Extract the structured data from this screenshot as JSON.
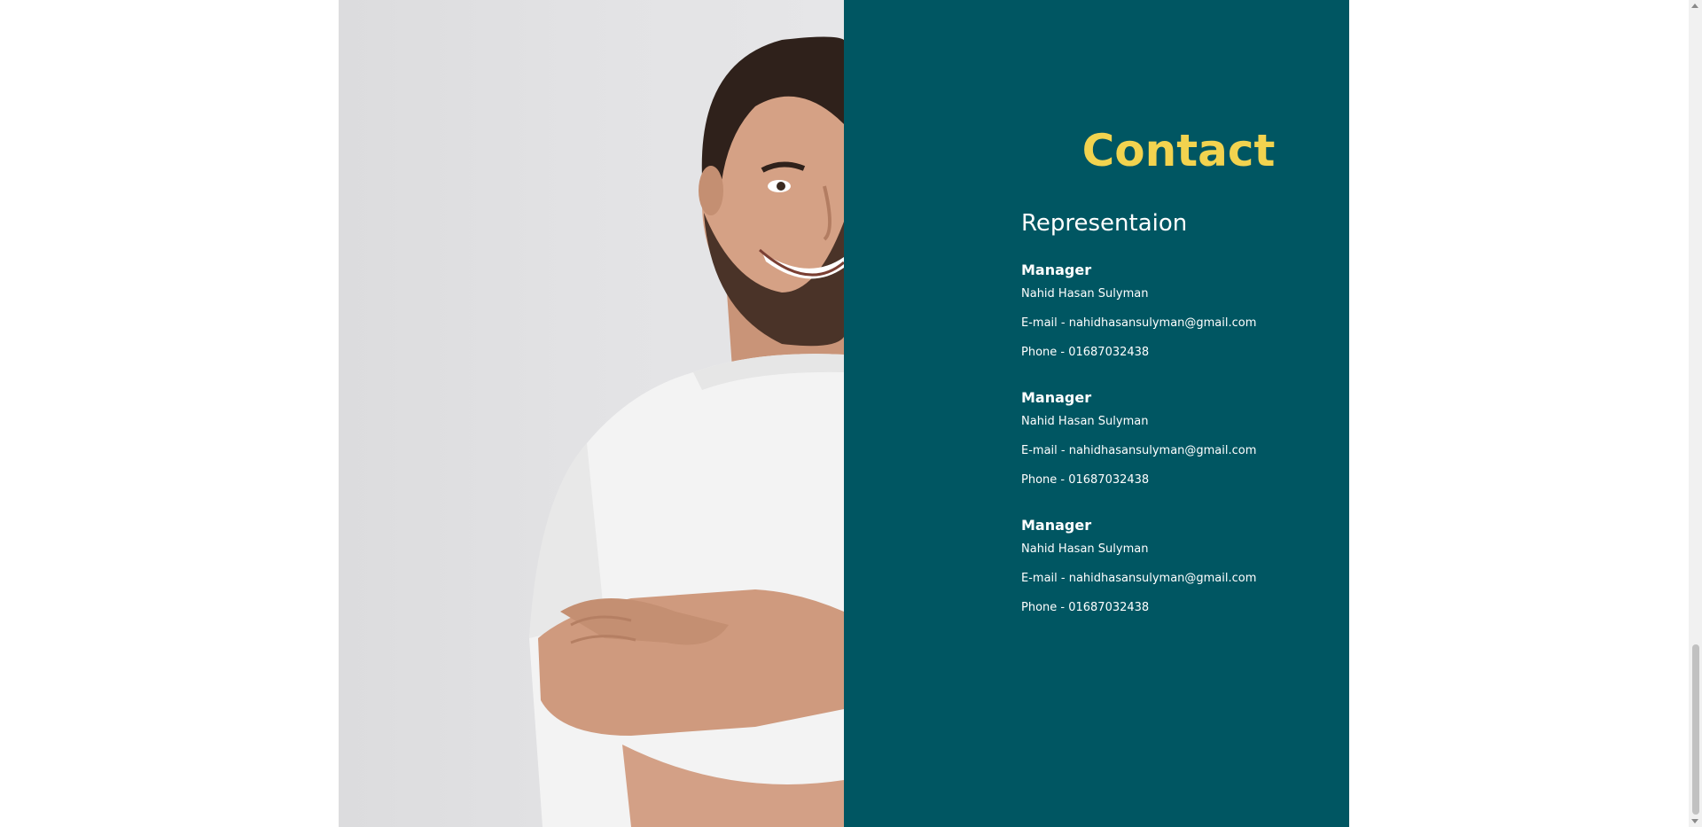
{
  "contact": {
    "title": "Contact",
    "subtitle": "Representaion",
    "people": [
      {
        "role": "Manager",
        "name": "Nahid Hasan Sulyman",
        "email": "E-mail - nahidhasansulyman@gmail.com",
        "phone": "Phone - 01687032438"
      },
      {
        "role": "Manager",
        "name": "Nahid Hasan Sulyman",
        "email": "E-mail - nahidhasansulyman@gmail.com",
        "phone": "Phone - 01687032438"
      },
      {
        "role": "Manager",
        "name": "Nahid Hasan Sulyman",
        "email": "E-mail - nahidhasansulyman@gmail.com",
        "phone": "Phone - 01687032438"
      }
    ]
  },
  "colors": {
    "panel_background": "#005662",
    "title_accent": "#f2d34f",
    "photo_background": "#e1e1e3"
  },
  "scrollbar": {
    "scroll_position": 0.95
  }
}
